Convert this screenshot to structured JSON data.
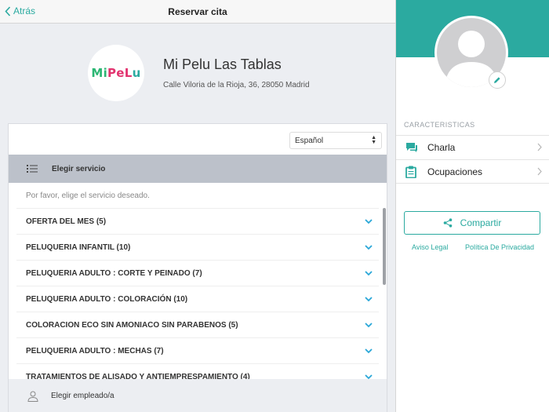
{
  "nav": {
    "back_label": "Atrás",
    "title": "Reservar cita"
  },
  "shop": {
    "logo": {
      "part1": "Mi ",
      "part2": "PeL",
      "part3": "u"
    },
    "name": "Mi Pelu Las Tablas",
    "address": "Calle Viloria de la Rioja, 36, 28050 Madrid"
  },
  "booking": {
    "language": "Español",
    "service_header": "Elegir servicio",
    "hint": "Por favor, elige el servicio deseado.",
    "services": [
      "OFERTA DEL MES (5)",
      "PELUQUERIA INFANTIL (10)",
      "PELUQUERIA ADULTO : CORTE Y PEINADO (7)",
      "PELUQUERIA ADULTO : COLORACIÓN (10)",
      "COLORACION ECO SIN AMONIACO SIN PARABENOS (5)",
      "PELUQUERIA ADULTO : MECHAS (7)",
      "TRATAMIENTOS DE ALISADO Y ANTIEMPRESPAMIENTO (4)"
    ],
    "employee_label": "Elegir empleado/a"
  },
  "sidebar": {
    "section_title": "CARACTERISTICAS",
    "items": [
      {
        "label": "Charla",
        "icon": "chat-icon"
      },
      {
        "label": "Ocupaciones",
        "icon": "clipboard-icon"
      }
    ],
    "share_label": "Compartir",
    "links": {
      "legal": "Aviso Legal",
      "privacy": "Política De Privacidad"
    }
  },
  "colors": {
    "accent": "#2baaa0",
    "chevron": "#2aa7d8",
    "header_bar": "#bcc1ca"
  }
}
